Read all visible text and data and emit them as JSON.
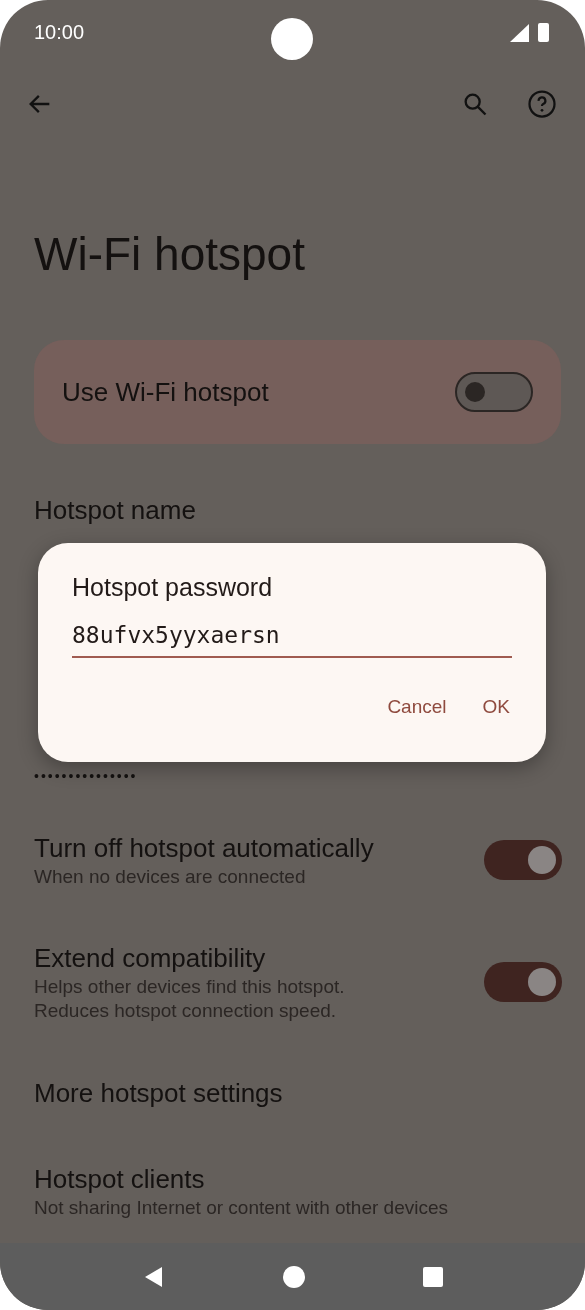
{
  "status_bar": {
    "time": "10:00"
  },
  "page": {
    "title": "Wi-Fi hotspot"
  },
  "main_toggle": {
    "label": "Use Wi-Fi hotspot",
    "on": false
  },
  "hotspot_name": {
    "title": "Hotspot name"
  },
  "password_mask": "•••••••••••••••",
  "switch_items": [
    {
      "title": "Turn off hotspot automatically",
      "subtitle": "When no devices are connected",
      "on": true
    },
    {
      "title": "Extend compatibility",
      "subtitle": "Helps other devices find this hotspot.\nReduces hotspot connection speed.",
      "on": true
    }
  ],
  "links": [
    {
      "title": "More hotspot settings"
    },
    {
      "title": "Hotspot clients",
      "subtitle": "Not sharing Internet or content with other devices"
    }
  ],
  "dialog": {
    "title": "Hotspot password",
    "value": "88ufvx5yyxaersn",
    "buttons": [
      "Cancel",
      "OK"
    ]
  }
}
